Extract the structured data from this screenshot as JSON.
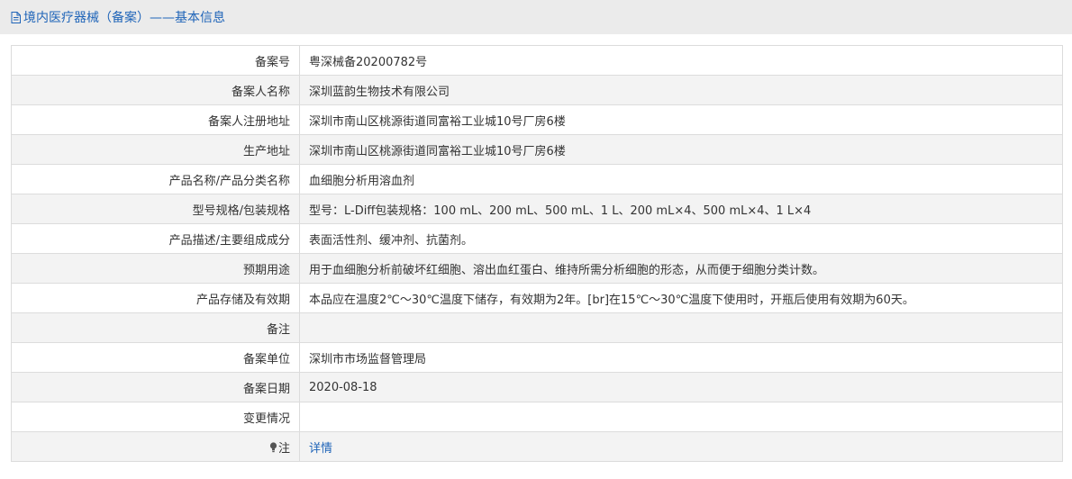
{
  "header": {
    "title": "境内医疗器械（备案）——基本信息",
    "accent_color": "#1f64b8"
  },
  "rows": [
    {
      "label": "备案号",
      "value": "粤深械备20200782号"
    },
    {
      "label": "备案人名称",
      "value": "深圳蓝韵生物技术有限公司"
    },
    {
      "label": "备案人注册地址",
      "value": "深圳市南山区桃源街道同富裕工业城10号厂房6楼"
    },
    {
      "label": "生产地址",
      "value": "深圳市南山区桃源街道同富裕工业城10号厂房6楼"
    },
    {
      "label": "产品名称/产品分类名称",
      "value": "血细胞分析用溶血剂"
    },
    {
      "label": "型号规格/包装规格",
      "value": "型号：L-Diff包装规格：100 mL、200 mL、500 mL、1 L、200 mL×4、500 mL×4、1 L×4"
    },
    {
      "label": "产品描述/主要组成成分",
      "value": "表面活性剂、缓冲剂、抗菌剂。"
    },
    {
      "label": "预期用途",
      "value": "用于血细胞分析前破坏红细胞、溶出血红蛋白、维持所需分析细胞的形态，从而便于细胞分类计数。"
    },
    {
      "label": "产品存储及有效期",
      "value": "本品应在温度2℃～30℃温度下储存，有效期为2年。[br]在15℃～30℃温度下使用时，开瓶后使用有效期为60天。"
    },
    {
      "label": "备注",
      "value": ""
    },
    {
      "label": "备案单位",
      "value": "深圳市市场监督管理局"
    },
    {
      "label": "备案日期",
      "value": "2020-08-18"
    },
    {
      "label": "变更情况",
      "value": ""
    }
  ],
  "note": {
    "icon": "lightbulb-icon",
    "label": "注",
    "link_text": "详情"
  }
}
